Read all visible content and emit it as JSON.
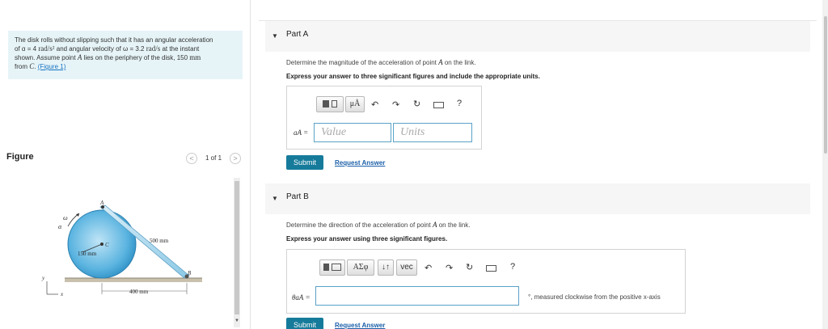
{
  "problem": {
    "line1": "The disk rolls without slipping such that it has an angular acceleration",
    "line2_pre": "of α = 4 ",
    "line2_unit1": "rad/s²",
    "line2_mid": " and angular velocity of ω = 3.2 ",
    "line2_unit2": "rad/s",
    "line2_post": " at the instant",
    "line3_pre": "shown. Assume point ",
    "line3_point": "A",
    "line3_mid": " lies on the periphery of the disk, 150 ",
    "line3_unit": "mm",
    "line4_pre": "from ",
    "line4_point": "C",
    "line4_mid": ". ",
    "figure_link": "(Figure 1)"
  },
  "figure": {
    "title": "Figure",
    "prev": "<",
    "count": "1 of 1",
    "next": ">",
    "labels": {
      "omega": "ω",
      "alpha": "α",
      "point_a": "A",
      "point_c": "C",
      "point_b": "B",
      "radius": "150 mm",
      "link_len": "500 mm",
      "dist": "400 mm",
      "axis_y": "y",
      "axis_x": "x"
    }
  },
  "partA": {
    "title": "Part A",
    "question_pre": "Determine the magnitude of the acceleration of point ",
    "question_point": "A",
    "question_post": " on the link.",
    "instruction": "Express your answer to three significant figures and include the appropriate units.",
    "var_label": "aA =",
    "value_placeholder": "Value",
    "units_placeholder": "Units",
    "mu_button": "μÅ",
    "help": "?",
    "submit": "Submit",
    "request": "Request Answer"
  },
  "partB": {
    "title": "Part B",
    "question_pre": "Determine the direction of the acceleration of point ",
    "question_point": "A",
    "question_post": " on the link.",
    "instruction": "Express your answer using three significant figures.",
    "var_label": "θaA =",
    "sym_button": "ΑΣφ",
    "sort_button": "↓↑",
    "vec_button": "vec",
    "help": "?",
    "suffix": "°, measured clockwise from the positive x-axis",
    "submit": "Submit",
    "request": "Request Answer"
  },
  "colors": {
    "submit_bg": "#167b9b",
    "problem_bg": "#e6f4f8",
    "link": "#1a73c1",
    "field_border": "#5aa2c8",
    "disk": "#5bb4e0"
  }
}
